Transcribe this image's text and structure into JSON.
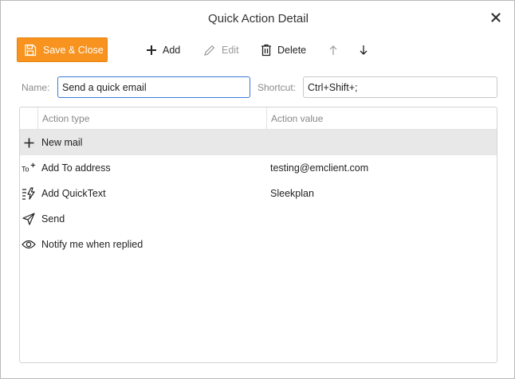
{
  "window": {
    "title": "Quick Action Detail"
  },
  "toolbar": {
    "save_close": "Save & Close",
    "add": "Add",
    "edit": "Edit",
    "delete": "Delete"
  },
  "form": {
    "name_label": "Name:",
    "name_value": "Send a quick email",
    "shortcut_label": "Shortcut:",
    "shortcut_value": "Ctrl+Shift+;"
  },
  "grid": {
    "columns": [
      "Action type",
      "Action value"
    ],
    "rows": [
      {
        "icon": "plus-icon",
        "type": "New mail",
        "value": "",
        "selected": true
      },
      {
        "icon": "to-plus-icon",
        "type": "Add To address",
        "value": "testing@emclient.com",
        "selected": false
      },
      {
        "icon": "quicktext-icon",
        "type": "Add QuickText",
        "value": "Sleekplan",
        "selected": false
      },
      {
        "icon": "send-icon",
        "type": "Send",
        "value": "",
        "selected": false
      },
      {
        "icon": "eye-icon",
        "type": "Notify me when replied",
        "value": "",
        "selected": false
      }
    ]
  },
  "colors": {
    "accent": "#f7931e",
    "focus_border": "#3a7bd5",
    "selected_row": "#e8e8e8"
  }
}
